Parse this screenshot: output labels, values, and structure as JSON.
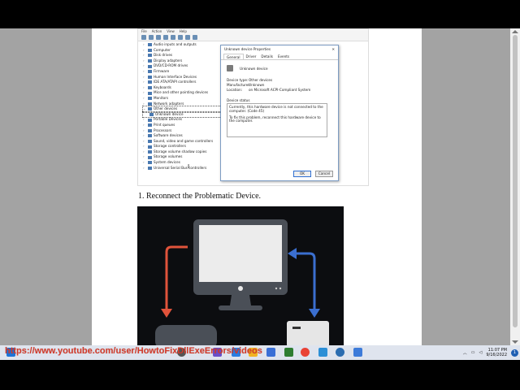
{
  "device_manager": {
    "menu": [
      "File",
      "Action",
      "View",
      "Help"
    ],
    "tree": [
      {
        "label": "Audio inputs and outputs",
        "expanded": false
      },
      {
        "label": "Computer",
        "expanded": false
      },
      {
        "label": "Disk drives",
        "expanded": false
      },
      {
        "label": "Display adapters",
        "expanded": false
      },
      {
        "label": "DVD/CD-ROM drives",
        "expanded": false
      },
      {
        "label": "Firmware",
        "expanded": false
      },
      {
        "label": "Human Interface Devices",
        "expanded": false
      },
      {
        "label": "IDE ATA/ATAPI controllers",
        "expanded": false
      },
      {
        "label": "Keyboards",
        "expanded": false
      },
      {
        "label": "Mice and other pointing devices",
        "expanded": false
      },
      {
        "label": "Monitors",
        "expanded": false
      },
      {
        "label": "Network adapters",
        "expanded": false
      },
      {
        "label": "Other devices",
        "expanded": true
      },
      {
        "label": "Unknown device",
        "child": true
      },
      {
        "label": "Portable Devices",
        "expanded": false
      },
      {
        "label": "Print queues",
        "expanded": false
      },
      {
        "label": "Processors",
        "expanded": false
      },
      {
        "label": "Software devices",
        "expanded": false
      },
      {
        "label": "Sound, video and game controllers",
        "expanded": false
      },
      {
        "label": "Storage controllers",
        "expanded": false
      },
      {
        "label": "Storage volume shadow copies",
        "expanded": false
      },
      {
        "label": "Storage volumes",
        "expanded": false
      },
      {
        "label": "System devices",
        "expanded": false
      },
      {
        "label": "Universal Serial Bus controllers",
        "expanded": false
      }
    ]
  },
  "dialog": {
    "title": "Unknown device Properties",
    "close": "✕",
    "tabs": [
      "General",
      "Driver",
      "Details",
      "Events"
    ],
    "device_name": "Unknown device",
    "props": [
      {
        "key": "Device type:",
        "value": "Other devices"
      },
      {
        "key": "Manufacturer:",
        "value": "Unknown"
      },
      {
        "key": "Location:",
        "value": "on Microsoft ACPI-Compliant System"
      }
    ],
    "status_label": "Device status",
    "status_text_1": "Currently, this hardware device is not connected to the computer. (Code 45)",
    "status_text_2": "To fix this problem, reconnect this hardware device to the computer.",
    "ok": "OK",
    "cancel": "Cancel"
  },
  "article": {
    "heading": "1. Reconnect the Problematic Device."
  },
  "illustration": {
    "left_arrow_color": "#e0533b",
    "right_arrow_color": "#3b6fd0",
    "monitor_color": "#4a4f57",
    "screen_color": "#ececec"
  },
  "overlay": {
    "url": "https://www.youtube.com/user/HowtoFixDllExeErrors/videos"
  },
  "taskbar": {
    "time": "11:07 PM",
    "date": "9/16/2022",
    "notifications": "1"
  }
}
